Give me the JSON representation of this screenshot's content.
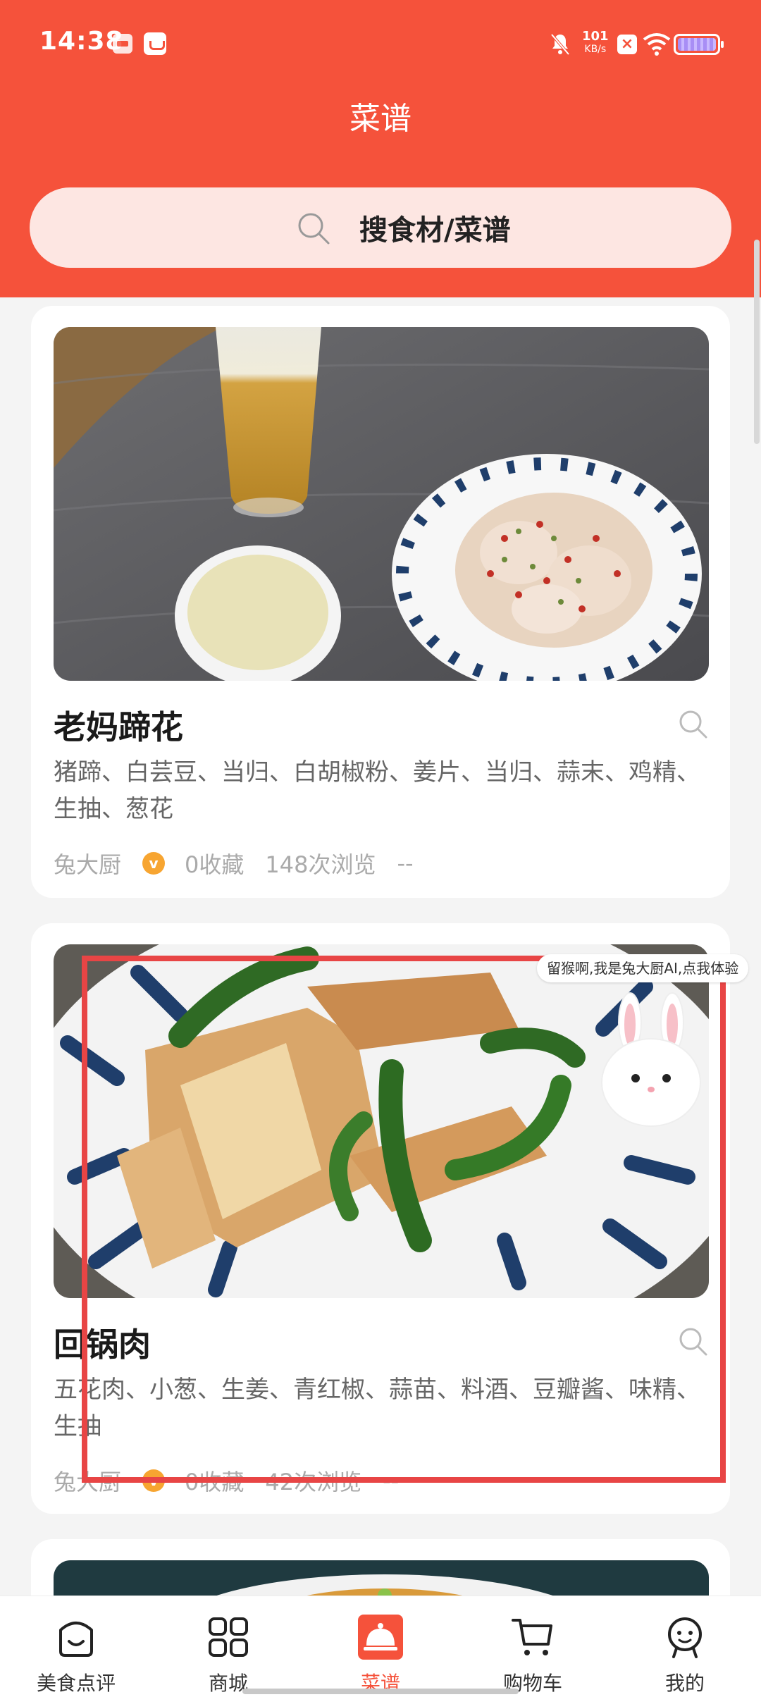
{
  "status_bar": {
    "time": "14:38",
    "speed_value": "101",
    "speed_unit": "KB/s"
  },
  "header": {
    "title": "菜谱",
    "search_placeholder": "搜食材/菜谱"
  },
  "recipes": [
    {
      "title": "老妈蹄花",
      "ingredients": "猪蹄、白芸豆、当归、白胡椒粉、姜片、当归、蒜末、鸡精、生抽、葱花",
      "author": "兔大厨",
      "favorites": "0收藏",
      "views": "148次浏览",
      "extra": "--"
    },
    {
      "title": "回锅肉",
      "ingredients": "五花肉、小葱、生姜、青红椒、蒜苗、料酒、豆瓣酱、味精、生抽",
      "author": "兔大厨",
      "favorites": "0收藏",
      "views": "42次浏览",
      "extra": "--"
    }
  ],
  "ai_tip": "留猴啊,我是兔大厨AI,点我体验",
  "bottom_nav": [
    {
      "label": "美食点评",
      "icon": "smile-bag-icon"
    },
    {
      "label": "商城",
      "icon": "grid-icon"
    },
    {
      "label": "菜谱",
      "icon": "cloche-icon",
      "active": true
    },
    {
      "label": "购物车",
      "icon": "cart-icon"
    },
    {
      "label": "我的",
      "icon": "profile-icon"
    }
  ],
  "colors": {
    "accent": "#f5523b",
    "search_bg": "#fde6e2",
    "badge": "#f7a531",
    "highlight": "#e84545"
  }
}
